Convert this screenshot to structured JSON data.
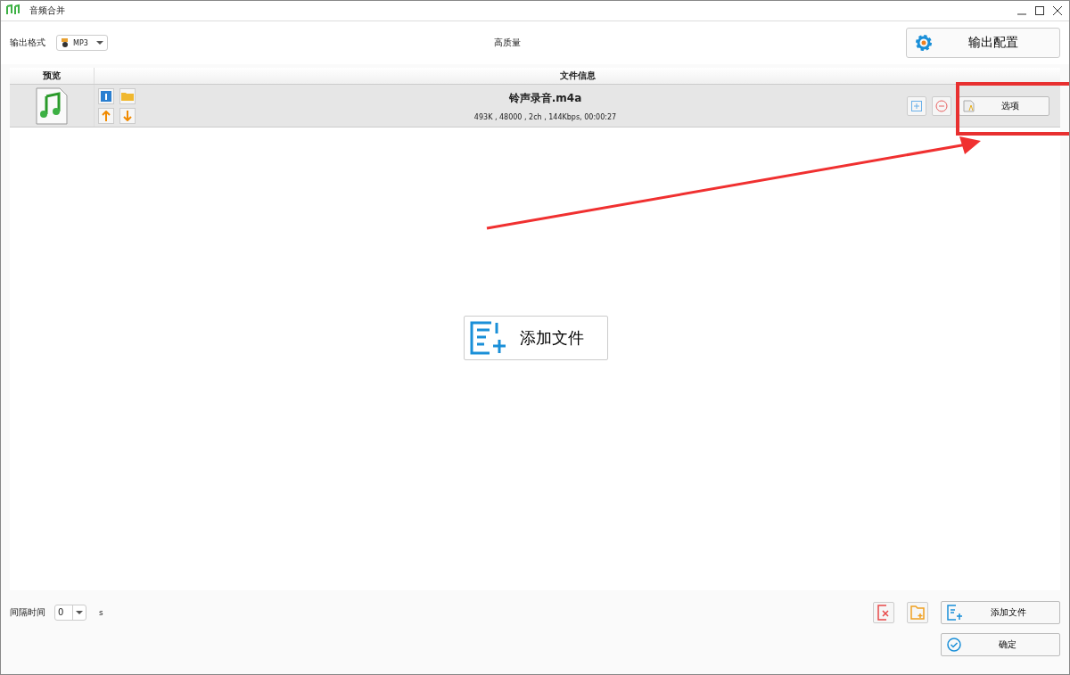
{
  "window": {
    "title": "音频合并"
  },
  "toolbar": {
    "format_label": "输出格式",
    "format_value": "MP3",
    "quality": "高质量",
    "config_button": "输出配置"
  },
  "table": {
    "columns": [
      "预览",
      "文件信息"
    ],
    "rows": [
      {
        "name": "铃声录音.m4a",
        "details": "493K , 48000 , 2ch , 144Kbps, 00:00:27",
        "options_button": "选项"
      }
    ]
  },
  "center_button": "添加文件",
  "footer": {
    "interval_label": "间隔时间",
    "interval_value": "0",
    "interval_unit": "s",
    "add_button": "添加文件",
    "confirm_button": "确定"
  }
}
